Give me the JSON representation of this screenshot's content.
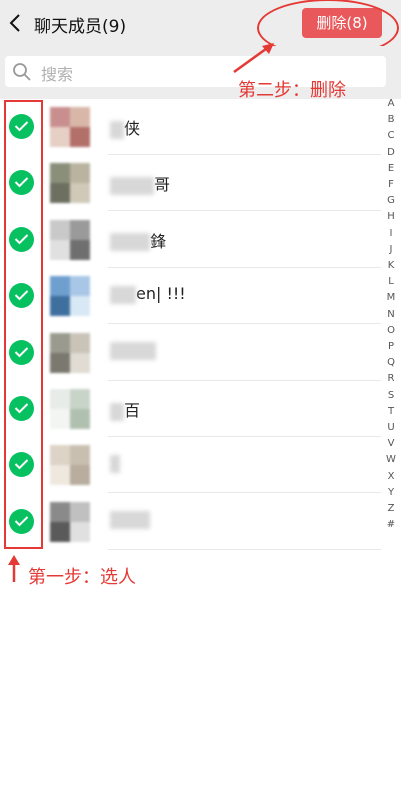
{
  "header": {
    "title": "聊天成员(9)",
    "delete_label": "删除(8)"
  },
  "search": {
    "placeholder": "搜索"
  },
  "annotations": {
    "step1": "第一步：选人",
    "step2": "第二步：删除"
  },
  "members": [
    {
      "name": "侠",
      "avatar_colors": [
        "#c98f8f",
        "#d9b7a8",
        "#e6cfc4",
        "#b36f6a"
      ]
    },
    {
      "name": "哥",
      "avatar_colors": [
        "#8a8f7a",
        "#b9b3a0",
        "#6d6f60",
        "#d0c9b8"
      ]
    },
    {
      "name": "鋒",
      "avatar_colors": [
        "#c9c9c9",
        "#9a9a9a",
        "#e0e0e0",
        "#6f6f6f"
      ]
    },
    {
      "name": "en| !!!",
      "avatar_colors": [
        "#6f9fcf",
        "#a8c7e6",
        "#3f6f9f",
        "#d9e8f5"
      ]
    },
    {
      "name": "",
      "avatar_colors": [
        "#9a9a8f",
        "#c9c3b8",
        "#7a786f",
        "#e0dcd3"
      ]
    },
    {
      "name": "百",
      "avatar_colors": [
        "#e8ece8",
        "#c9d4c9",
        "#f3f5f3",
        "#b0c0b0"
      ]
    },
    {
      "name": "",
      "avatar_colors": [
        "#ddd3c6",
        "#c9bfb0",
        "#eee8df",
        "#b8ad9e"
      ]
    },
    {
      "name": "",
      "avatar_colors": [
        "#8a8a8a",
        "#c0c0c0",
        "#5a5a5a",
        "#e0e0e0"
      ]
    }
  ],
  "alphabet": [
    "A",
    "B",
    "C",
    "D",
    "E",
    "F",
    "G",
    "H",
    "I",
    "J",
    "K",
    "L",
    "M",
    "N",
    "O",
    "P",
    "Q",
    "R",
    "S",
    "T",
    "U",
    "V",
    "W",
    "X",
    "Y",
    "Z",
    "#"
  ],
  "colors": {
    "accent": "#07c160",
    "delete": "#e9585a",
    "annotation": "#e53935"
  }
}
